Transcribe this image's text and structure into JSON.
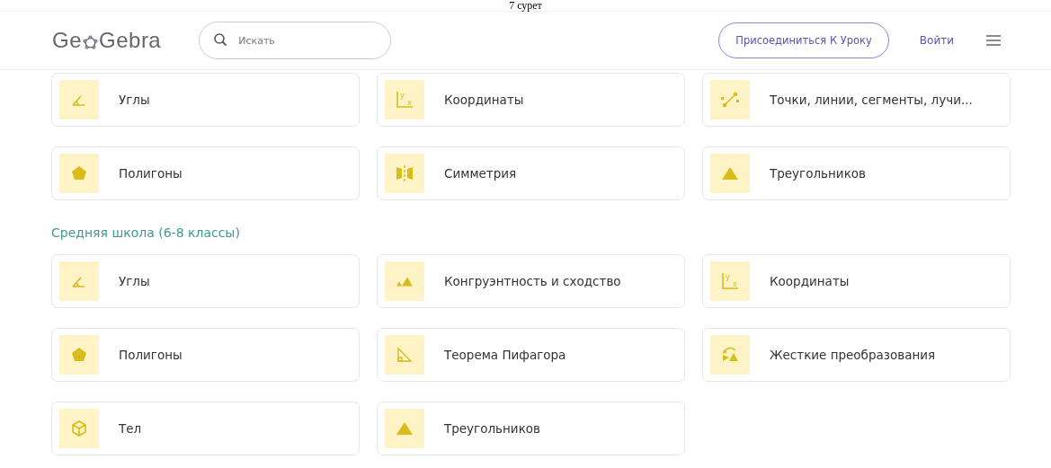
{
  "caption": "7 сурет",
  "header": {
    "logo_left": "Ge",
    "logo_right": "Gebra",
    "search": {
      "placeholder": "Искать"
    },
    "join_button": "Присоединиться К Уроку",
    "login_link": "Войти"
  },
  "sections": [
    {
      "topics": [
        {
          "label": "Углы",
          "kind": "angle"
        },
        {
          "label": "Координаты",
          "kind": "coordinates",
          "axis_labels": {
            "y": "y",
            "x": "x"
          }
        },
        {
          "label": "Точки, линии, сегменты, лучи...",
          "kind": "segment"
        },
        {
          "label": "Полигоны",
          "kind": "polygon"
        },
        {
          "label": "Симметрия",
          "kind": "symmetry"
        },
        {
          "label": "Треугольников",
          "kind": "triangle"
        }
      ]
    },
    {
      "title": "Средняя школа (6-8 классы)",
      "topics": [
        {
          "label": "Углы",
          "kind": "angle"
        },
        {
          "label": "Конгруэнтность и сходство",
          "kind": "congruence"
        },
        {
          "label": "Координаты",
          "kind": "coordinates",
          "axis_labels": {
            "y": "y",
            "x": "x"
          }
        },
        {
          "label": "Полигоны",
          "kind": "polygon"
        },
        {
          "label": "Теорема Пифагора",
          "kind": "pythagoras"
        },
        {
          "label": "Жесткие преобразования",
          "kind": "transform"
        },
        {
          "label": "Тел",
          "kind": "solid"
        },
        {
          "label": "Треугольников",
          "kind": "triangle"
        }
      ]
    }
  ]
}
